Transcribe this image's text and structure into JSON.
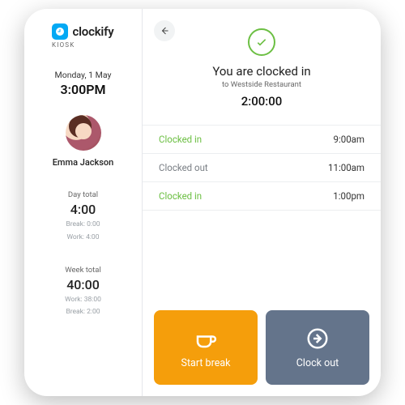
{
  "brand": {
    "name": "clockify",
    "subtitle": "KIOSK"
  },
  "sidebar": {
    "date": "Monday, 1 May",
    "time": "3:00PM",
    "user_name": "Emma Jackson",
    "day": {
      "label": "Day total",
      "value": "4:00",
      "break": "Break: 0:00",
      "work": "Work: 4:00"
    },
    "week": {
      "label": "Week total",
      "value": "40:00",
      "work": "Work: 38:00",
      "break": "Break: 2:00"
    }
  },
  "main": {
    "status_title": "You are clocked in",
    "status_sub": "to Westside Restaurant",
    "timer": "2:00:00",
    "log": [
      {
        "label": "Clocked in",
        "time": "9:00am",
        "tone": "green"
      },
      {
        "label": "Clocked out",
        "time": "11:00am",
        "tone": "grey"
      },
      {
        "label": "Clocked in",
        "time": "1:00pm",
        "tone": "green"
      }
    ],
    "actions": {
      "start_break": "Start break",
      "clock_out": "Clock out"
    }
  }
}
